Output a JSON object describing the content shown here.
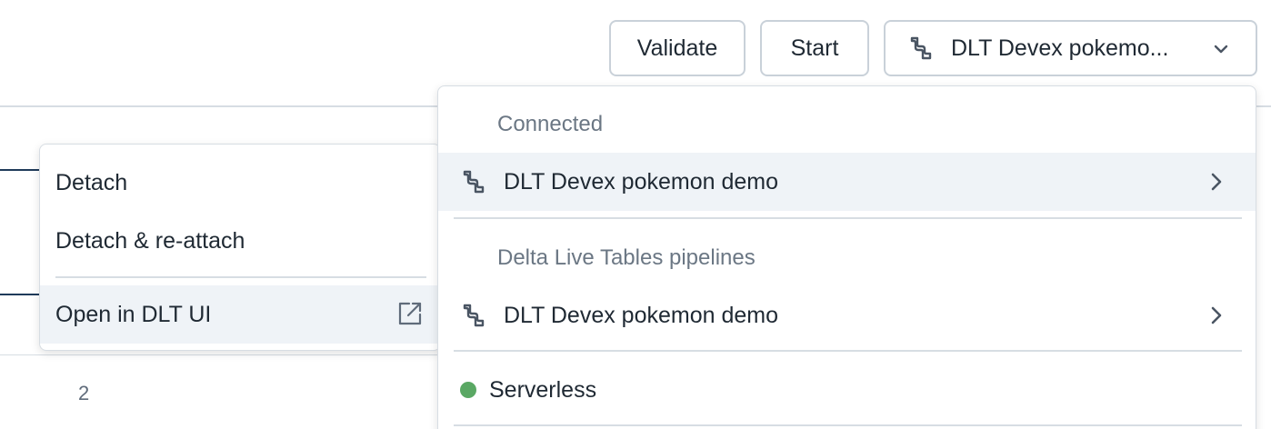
{
  "toolbar": {
    "validate_label": "Validate",
    "start_label": "Start",
    "pipeline_selector_label": "DLT Devex pokemo..."
  },
  "background": {
    "row_number": "2"
  },
  "context_menu": {
    "items": [
      {
        "label": "Detach"
      },
      {
        "label": "Detach & re-attach"
      },
      {
        "label": "Open in DLT UI",
        "icon": "external-link-icon"
      }
    ]
  },
  "dropdown": {
    "connected_label": "Connected",
    "connected_item": "DLT Devex pokemon demo",
    "pipelines_label": "Delta Live Tables pipelines",
    "pipeline_item": "DLT Devex pokemon demo",
    "compute_item": "Serverless"
  },
  "icons": {
    "pipeline": "pipeline-icon",
    "chevron_down": "chevron-down-icon",
    "chevron_right": "chevron-right-icon",
    "external_link": "external-link-icon",
    "status": "status-dot-icon"
  },
  "colors": {
    "status_green": "#5aa864",
    "highlight": "#eff3f7",
    "border": "#d7dde3",
    "muted_text": "#6b7784"
  }
}
